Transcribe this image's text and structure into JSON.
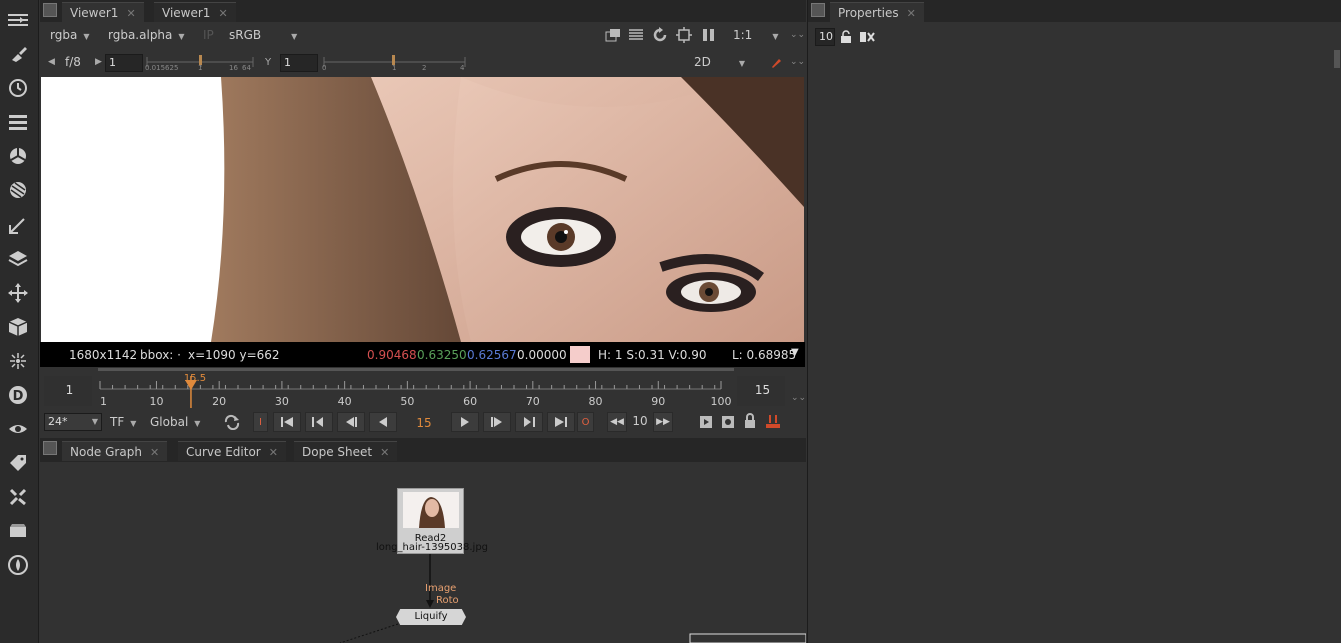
{
  "toolbar": {
    "icons": [
      "menu-icon",
      "paint-brush-icon",
      "clock-icon",
      "channels-icon",
      "color-wheel-icon",
      "sphere-icon",
      "filter-icon",
      "layers-icon",
      "transform-icon",
      "cube-icon",
      "particles-icon",
      "d-icon",
      "eye-icon",
      "tag-icon",
      "wrench-icon",
      "folder-icon",
      "flame-icon"
    ]
  },
  "viewer": {
    "tabs": [
      {
        "label": "Viewer1"
      },
      {
        "label": "Viewer1"
      }
    ],
    "channel": "rgba",
    "layer": "rgba.alpha",
    "ip_label": "IP",
    "colorspace": "sRGB",
    "zoom": "1:1",
    "fstop": "f/8",
    "gain_value": "1",
    "gain_ticks": [
      "0.015625",
      "1",
      "16",
      "64"
    ],
    "y_label": "Y",
    "gamma_value": "1",
    "gamma_ticks": [
      "0",
      "1",
      "2",
      "4"
    ],
    "view_mode": "2D",
    "info": {
      "resolution": "1680x1142",
      "bbox": "bbox: ·",
      "coords": "x=1090 y=662",
      "r": "0.90468",
      "g": "0.63250",
      "b": "0.62567",
      "a": "0.00000",
      "swatch_color": "#f5cdcb",
      "hsv": "H:  1 S:0.31 V:0.90",
      "lum": "L: 0.68985"
    },
    "timeline": {
      "start": "1",
      "end": "15",
      "current": "15.5",
      "ticks": [
        "1",
        "10",
        "20",
        "30",
        "40",
        "50",
        "60",
        "70",
        "80",
        "90",
        "100"
      ],
      "min": 1,
      "max": 100,
      "cursor": 15.5
    },
    "transport": {
      "fps": "24*",
      "tf": "TF",
      "global": "Global",
      "frame": "15",
      "increment": "10"
    }
  },
  "nodegraph": {
    "tabs": [
      {
        "label": "Node Graph"
      },
      {
        "label": "Curve Editor"
      },
      {
        "label": "Dope Sheet"
      }
    ],
    "read_node": {
      "name": "Read2",
      "file": "long_hair-1395038.jpg"
    },
    "pipe_labels": {
      "image": "Image",
      "roto": "Roto"
    },
    "liquify_node": {
      "name": "Liquify"
    }
  },
  "properties": {
    "tab": "Properties",
    "max_panels": "10"
  },
  "colors": {
    "accent": "#e08a3c",
    "bg": "#323232",
    "red": "#d45050",
    "green": "#5aa05a",
    "blue": "#5a7ad4"
  }
}
